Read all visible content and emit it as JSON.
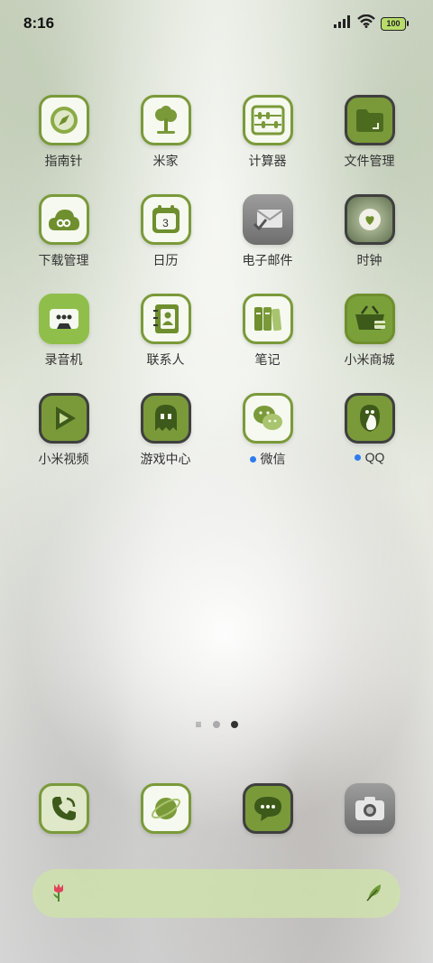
{
  "status_bar": {
    "time": "8:16",
    "battery": "100"
  },
  "apps": [
    {
      "label": "指南针",
      "icon": "compass-icon"
    },
    {
      "label": "米家",
      "icon": "tree-icon"
    },
    {
      "label": "计算器",
      "icon": "abacus-icon"
    },
    {
      "label": "文件管理",
      "icon": "folder-icon"
    },
    {
      "label": "下载管理",
      "icon": "cloud-download-icon"
    },
    {
      "label": "日历",
      "icon": "calendar-icon",
      "date": "3"
    },
    {
      "label": "电子邮件",
      "icon": "mail-icon"
    },
    {
      "label": "时钟",
      "icon": "clock-photo-icon"
    },
    {
      "label": "录音机",
      "icon": "cassette-icon"
    },
    {
      "label": "联系人",
      "icon": "contacts-book-icon"
    },
    {
      "label": "笔记",
      "icon": "notes-icon"
    },
    {
      "label": "小米商城",
      "icon": "shopping-basket-icon"
    },
    {
      "label": "小米视频",
      "icon": "play-icon"
    },
    {
      "label": "游戏中心",
      "icon": "ghost-icon"
    },
    {
      "label": "微信",
      "icon": "wechat-icon",
      "badge": true
    },
    {
      "label": "QQ",
      "icon": "penguin-icon",
      "badge": true
    }
  ],
  "dock": [
    {
      "icon": "phone-icon"
    },
    {
      "icon": "planet-browser-icon"
    },
    {
      "icon": "message-icon"
    },
    {
      "icon": "camera-icon"
    }
  ],
  "search_bar": {
    "left_icon": "tulip-icon",
    "right_icon": "leaf-icon"
  },
  "colors": {
    "accent": "#7a9a3a",
    "dark_green": "#6f8f2e",
    "badge": "#2f7bf0"
  }
}
